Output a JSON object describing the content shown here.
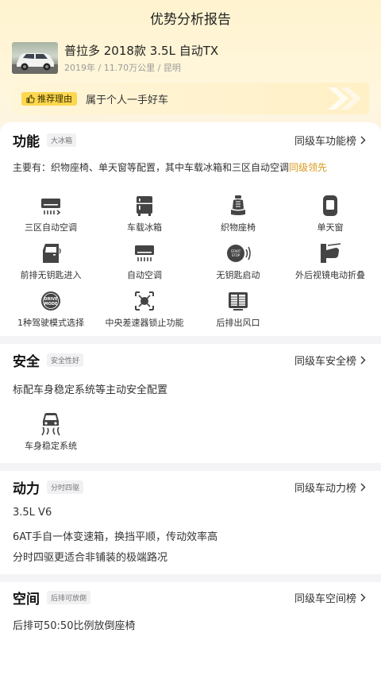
{
  "header": {
    "title": "优势分析报告"
  },
  "car": {
    "name": "普拉多 2018款 3.5L 自动TX",
    "meta": "2019年 / 11.70万公里 / 昆明"
  },
  "reason": {
    "tag": "推荐理由",
    "text": "属于个人一手好车"
  },
  "function": {
    "title": "功能",
    "tag": "大冰箱",
    "rank_link": "同级车功能榜",
    "summary": "主要有：织物座椅、单天窗等配置，其中车载冰箱和三区自动空调",
    "summary_highlight": "同级领先",
    "features": [
      {
        "label": "三区自动空调",
        "icon": "air-conditioner-icon"
      },
      {
        "label": "车载冰箱",
        "icon": "fridge-icon"
      },
      {
        "label": "织物座椅",
        "icon": "seat-icon"
      },
      {
        "label": "单天窗",
        "icon": "sunroof-icon"
      },
      {
        "label": "前排无钥匙进入",
        "icon": "keyless-entry-icon"
      },
      {
        "label": "自动空调",
        "icon": "auto-ac-icon"
      },
      {
        "label": "无钥匙启动",
        "icon": "start-button-icon"
      },
      {
        "label": "外后视镜电动折叠",
        "icon": "mirror-fold-icon"
      },
      {
        "label": "1种驾驶模式选择",
        "icon": "drive-mode-icon"
      },
      {
        "label": "中央差速器锁止功能",
        "icon": "diff-lock-icon"
      },
      {
        "label": "后排出风口",
        "icon": "rear-vent-icon"
      }
    ]
  },
  "safety": {
    "title": "安全",
    "tag": "安全性好",
    "rank_link": "同级车安全榜",
    "summary": "标配车身稳定系统等主动安全配置",
    "features": [
      {
        "label": "车身稳定系统",
        "icon": "stability-control-icon"
      }
    ]
  },
  "power": {
    "title": "动力",
    "tag": "分时四驱",
    "rank_link": "同级车动力榜",
    "lines": [
      "3.5L V6",
      "6AT手自一体变速箱，换挡平顺，传动效率高",
      "分时四驱更适合非铺装的极端路况"
    ]
  },
  "space": {
    "title": "空间",
    "tag": "后排可放倒",
    "rank_link": "同级车空间榜",
    "summary": "后排可50:50比例放倒座椅"
  },
  "colors": {
    "highlight": "#d99a1a",
    "tag_yellow": "#fcd74f",
    "icon": "#444444"
  }
}
